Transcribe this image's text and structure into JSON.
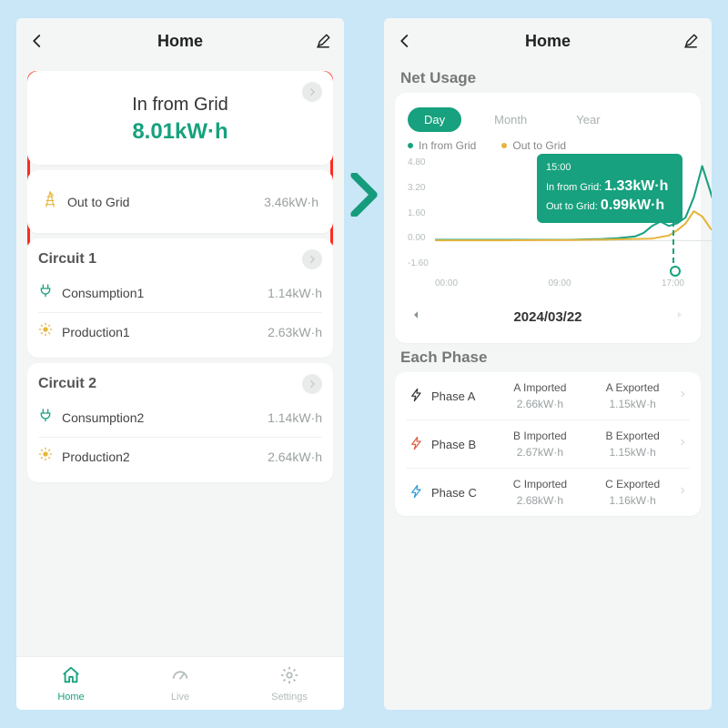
{
  "left": {
    "title": "Home",
    "grid_card": {
      "in_label": "In from Grid",
      "in_value": "8.01kW·h",
      "out_label": "Out to Grid",
      "out_value": "3.46kW·h"
    },
    "circuits": [
      {
        "name": "Circuit 1",
        "consumption_label": "Consumption1",
        "consumption_value": "1.14kW·h",
        "production_label": "Production1",
        "production_value": "2.63kW·h"
      },
      {
        "name": "Circuit 2",
        "consumption_label": "Consumption2",
        "consumption_value": "1.14kW·h",
        "production_label": "Production2",
        "production_value": "2.64kW·h"
      }
    ],
    "nav": {
      "home": "Home",
      "live": "Live",
      "settings": "Settings"
    }
  },
  "right": {
    "title": "Home",
    "section_net": "Net Usage",
    "periods": {
      "day": "Day",
      "month": "Month",
      "year": "Year"
    },
    "legend": {
      "in": "In from Grid",
      "out": "Out to Grid"
    },
    "tooltip": {
      "time": "15:00",
      "in_label": "In from Grid:",
      "in_value": "1.33kW·h",
      "out_label": "Out to Grid:",
      "out_value": "0.99kW·h"
    },
    "date": "2024/03/22",
    "y_ticks": [
      "4.80",
      "3.20",
      "1.60",
      "0.00",
      "-1.60"
    ],
    "x_ticks": [
      "00:00",
      "09:00",
      "17:00"
    ],
    "section_phase": "Each Phase",
    "phases": [
      {
        "name": "Phase A",
        "imp_label": "A Imported",
        "imp_value": "2.66kW·h",
        "exp_label": "A Exported",
        "exp_value": "1.15kW·h",
        "color": "#333"
      },
      {
        "name": "Phase B",
        "imp_label": "B Imported",
        "imp_value": "2.67kW·h",
        "exp_label": "B Exported",
        "exp_value": "1.15kW·h",
        "color": "#e05a3c"
      },
      {
        "name": "Phase C",
        "imp_label": "C Imported",
        "imp_value": "2.68kW·h",
        "exp_label": "C Exported",
        "exp_value": "1.16kW·h",
        "color": "#2f9bd6"
      }
    ]
  },
  "chart_data": {
    "type": "line",
    "x_range_hours": [
      0,
      17
    ],
    "ylim": [
      -1.6,
      4.8
    ],
    "xlabel": "",
    "ylabel": "",
    "series": [
      {
        "name": "In from Grid",
        "color": "#1aa181",
        "x": [
          0,
          2,
          4,
          6,
          8,
          9,
          10,
          11,
          12,
          12.5,
          13,
          13.5,
          14,
          14.5,
          15,
          15.5,
          16,
          16.5,
          17
        ],
        "values": [
          0.05,
          0.05,
          0.05,
          0.05,
          0.05,
          0.08,
          0.1,
          0.15,
          0.25,
          0.45,
          0.85,
          1.1,
          0.85,
          1.0,
          1.33,
          2.5,
          4.3,
          2.8,
          1.2
        ]
      },
      {
        "name": "Out to Grid",
        "color": "#e6b43c",
        "x": [
          0,
          2,
          4,
          6,
          8,
          9,
          10,
          11,
          12,
          13,
          14,
          14.5,
          15,
          15.5,
          16,
          16.5,
          17
        ],
        "values": [
          0.02,
          0.02,
          0.02,
          0.03,
          0.04,
          0.05,
          0.06,
          0.08,
          0.1,
          0.12,
          0.3,
          0.6,
          0.99,
          1.7,
          1.4,
          0.7,
          0.3
        ]
      }
    ],
    "highlight_x": 15,
    "highlight_values": {
      "In from Grid": 1.33,
      "Out to Grid": 0.99
    }
  }
}
